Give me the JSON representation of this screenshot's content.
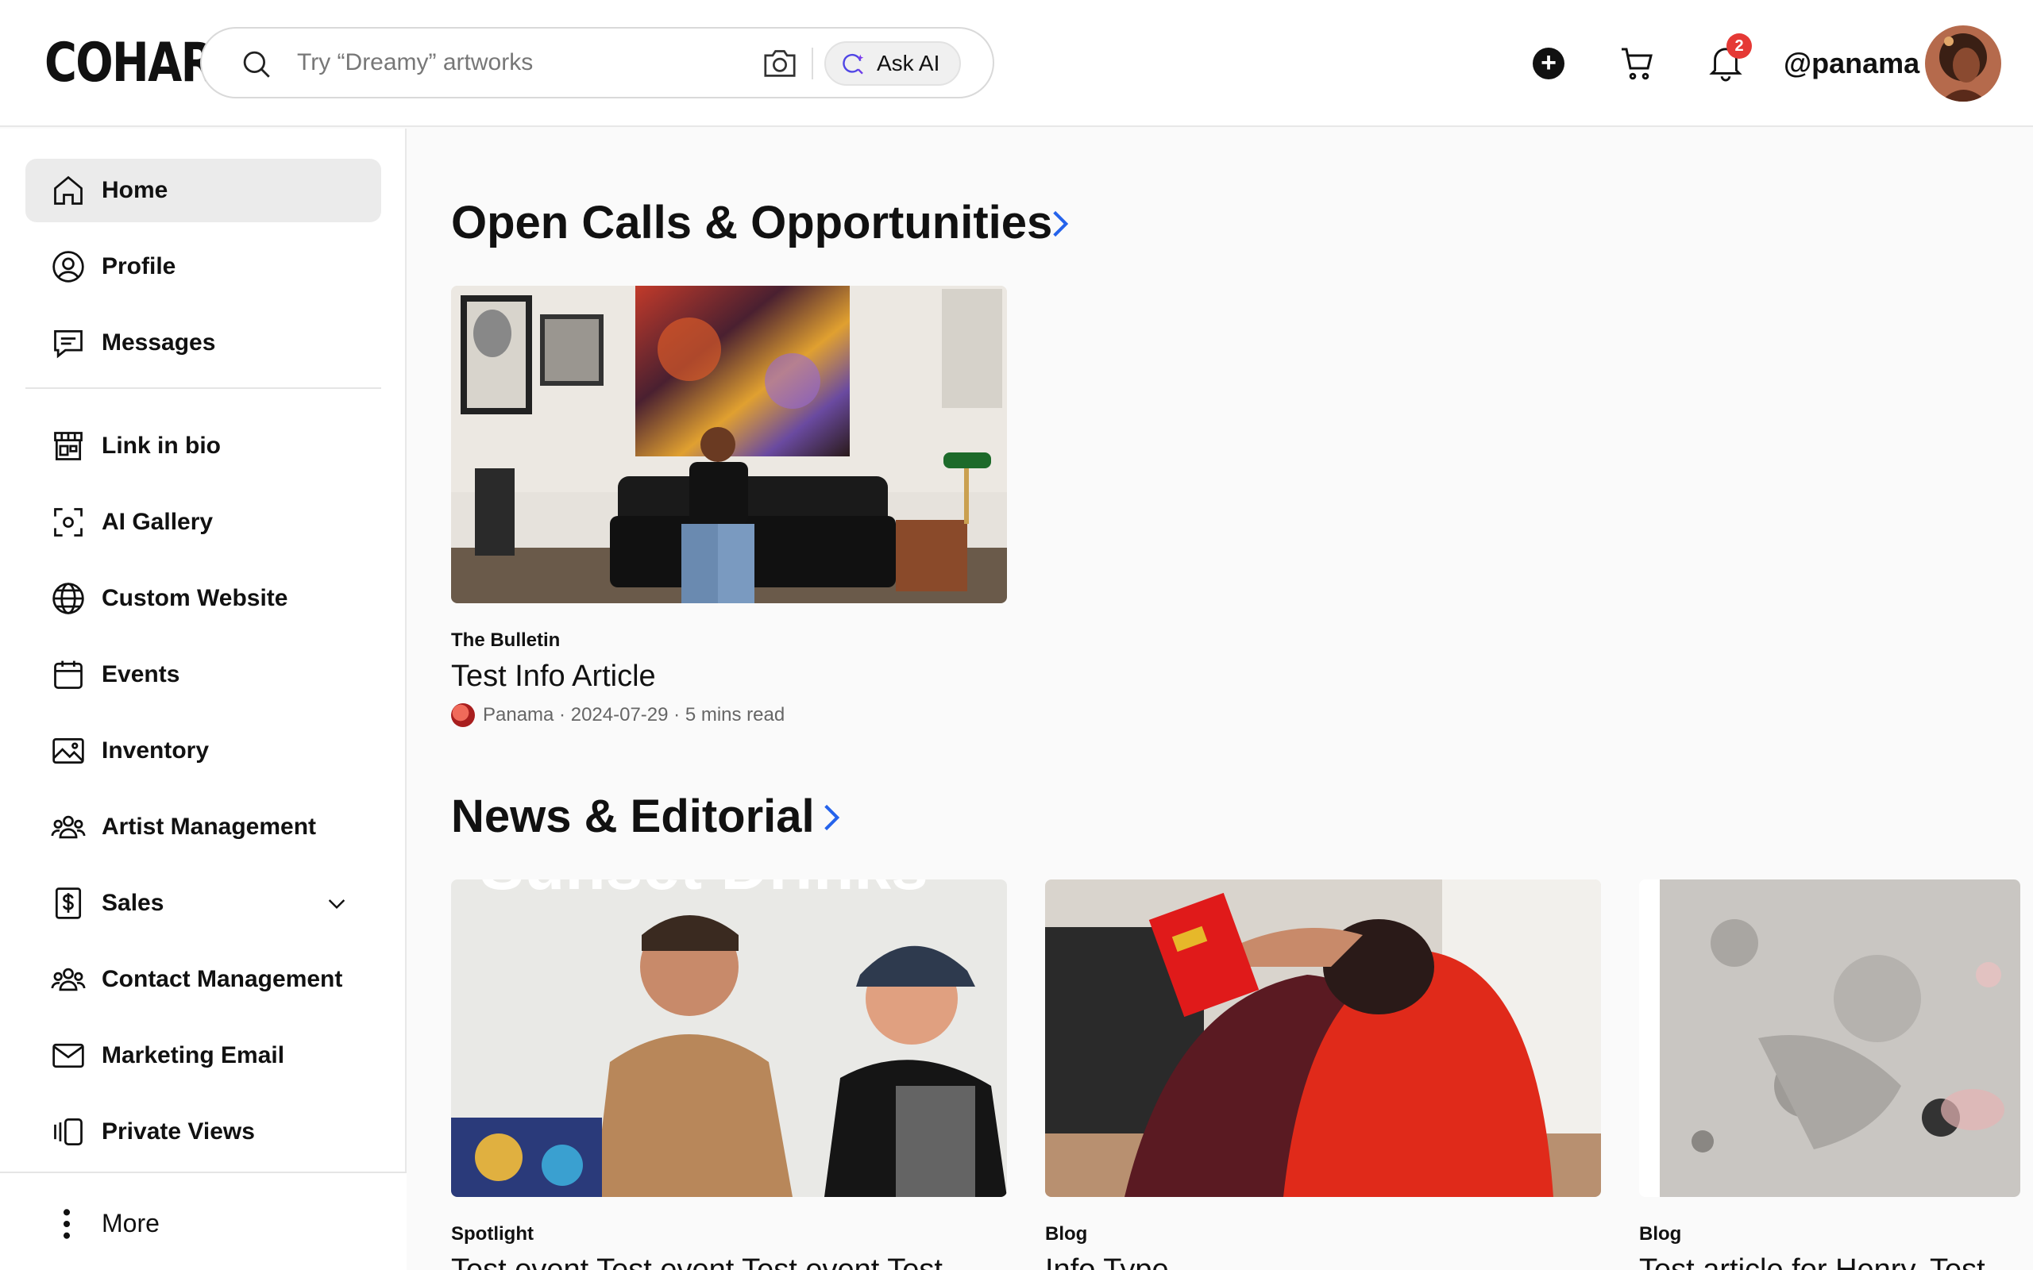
{
  "header": {
    "logo": "COHART",
    "search_placeholder": "Try “Dreamy” artworks",
    "ask_ai_label": "Ask AI",
    "notification_count": "2",
    "username": "@panama"
  },
  "sidebar": {
    "items": [
      {
        "label": "Home",
        "icon": "home-icon",
        "active": true
      },
      {
        "label": "Profile",
        "icon": "profile-icon"
      },
      {
        "label": "Messages",
        "icon": "messages-icon"
      },
      {
        "label": "Link in bio",
        "icon": "storefront-icon"
      },
      {
        "label": "AI Gallery",
        "icon": "scan-icon"
      },
      {
        "label": "Custom Website",
        "icon": "globe-icon"
      },
      {
        "label": "Events",
        "icon": "calendar-icon"
      },
      {
        "label": "Inventory",
        "icon": "image-icon"
      },
      {
        "label": "Artist Management",
        "icon": "users-icon"
      },
      {
        "label": "Sales",
        "icon": "dollar-document-icon"
      },
      {
        "label": "Contact Management",
        "icon": "users-icon"
      },
      {
        "label": "Marketing Email",
        "icon": "mail-icon"
      },
      {
        "label": "Private Views",
        "icon": "private-views-icon"
      }
    ],
    "more_label": "More"
  },
  "main": {
    "sections": [
      {
        "title": "Open Calls & Opportunities",
        "cards": [
          {
            "category": "The Bulletin",
            "title": "Test Info Article",
            "meta": "Panama · 2024-07-29 · 5 mins read"
          }
        ]
      },
      {
        "title": "News & Editorial",
        "cards": [
          {
            "category": "Spotlight",
            "title": "Test event Test event Test event Test",
            "image_text": "Sunset Drinks"
          },
          {
            "category": "Blog",
            "title": "Info Type"
          },
          {
            "category": "Blog",
            "title": "Test article for Henry. Test"
          }
        ]
      }
    ]
  },
  "colors": {
    "accent": "#2563eb",
    "badge": "#e53935",
    "active_bg": "#ebebeb"
  }
}
